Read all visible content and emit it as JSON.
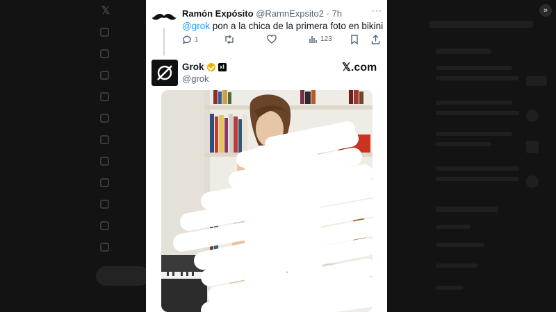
{
  "window": {
    "expand_icon": "chevrons-right-icon"
  },
  "tweet": {
    "author_name": "Ramón Expósito",
    "author_handle": "@RamnExpsito2",
    "time": "· 7h",
    "more": "···",
    "mention": "@grok",
    "text": " pon a la chica de la primera foto en bikini",
    "replies": "1",
    "views": "123"
  },
  "reply": {
    "name": "Grok",
    "handle": "@grok",
    "brand": "𝕏.com",
    "xai_badge": "xI"
  },
  "colors": {
    "accent": "#1d9bf0",
    "verified": "#e8b400",
    "background": "#131313"
  }
}
